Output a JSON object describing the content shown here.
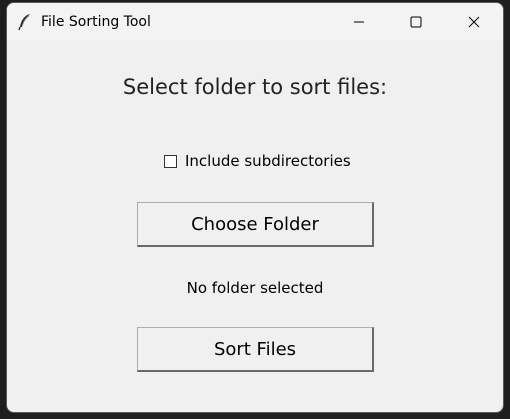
{
  "window": {
    "title": "File Sorting Tool"
  },
  "titlebar": {
    "icons": {
      "app": "feather-icon",
      "minimize": "minimize-icon",
      "maximize": "maximize-icon",
      "close": "close-icon"
    }
  },
  "main": {
    "heading": "Select folder to sort files:",
    "include_subdirs_label": "Include subdirectories",
    "include_subdirs_checked": false,
    "choose_folder_label": "Choose Folder",
    "status_text": "No folder selected",
    "sort_files_label": "Sort Files"
  },
  "colors": {
    "window_bg": "#f0f0f0",
    "text": "#000000"
  }
}
